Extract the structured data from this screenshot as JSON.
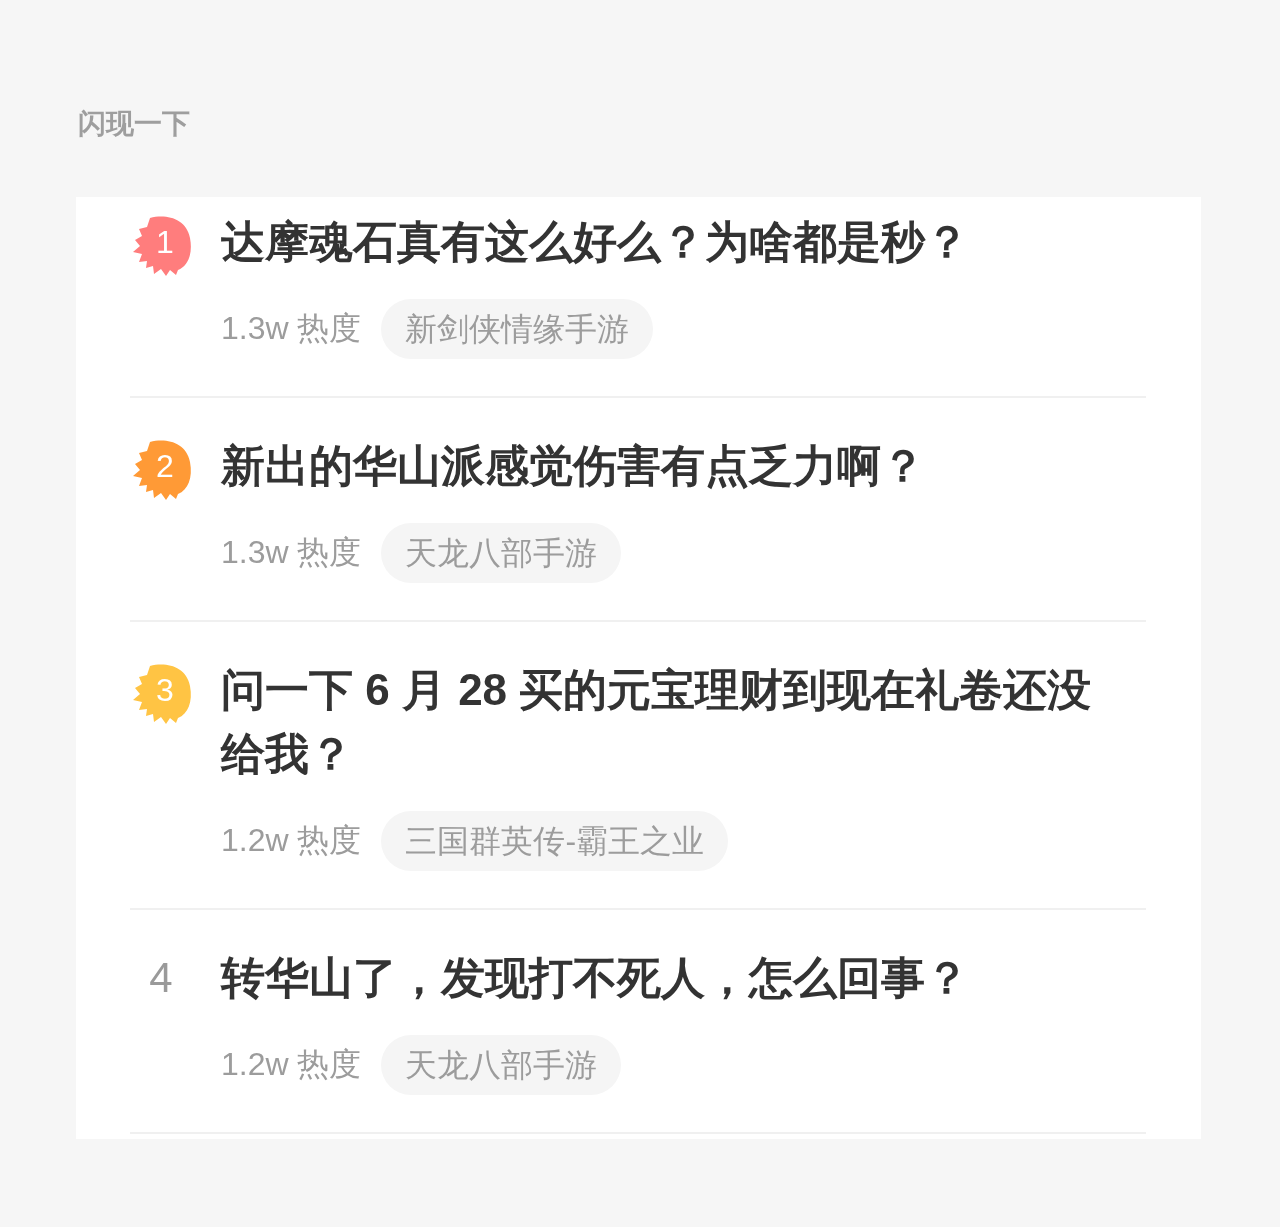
{
  "section": {
    "title": "闪现一下"
  },
  "items": [
    {
      "rank": "1",
      "kind": "badge",
      "color": "#ff7d7d",
      "title": "达摩魂石真有这么好么？为啥都是秒？",
      "heat": "1.3w 热度",
      "tag": "新剑侠情缘手游"
    },
    {
      "rank": "2",
      "kind": "badge",
      "color": "#ff9a36",
      "title": "新出的华山派感觉伤害有点乏力啊？",
      "heat": "1.3w 热度",
      "tag": "天龙八部手游"
    },
    {
      "rank": "3",
      "kind": "badge",
      "color": "#ffc444",
      "title": "问一下 6 月 28 买的元宝理财到现在礼卷还没给我？",
      "heat": "1.2w 热度",
      "tag": "三国群英传-霸王之业"
    },
    {
      "rank": "4",
      "kind": "plain",
      "title": "转华山了，发现打不死人，怎么回事？",
      "heat": "1.2w 热度",
      "tag": "天龙八部手游"
    }
  ]
}
